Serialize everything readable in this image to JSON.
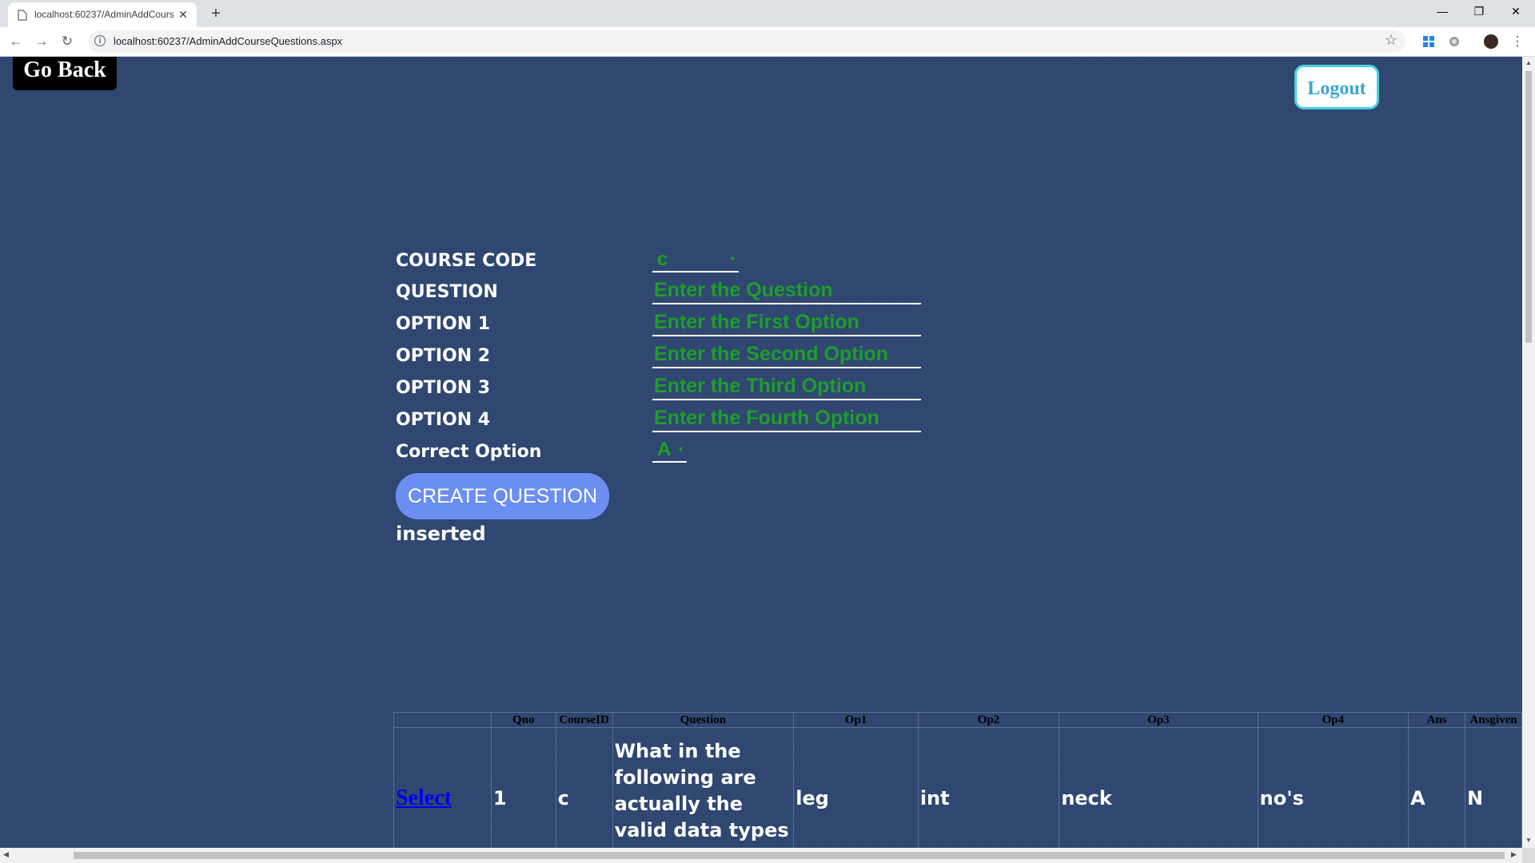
{
  "browser": {
    "tab_title": "localhost:60237/AdminAddCours",
    "url": "localhost:60237/AdminAddCourseQuestions.aspx"
  },
  "nav": {
    "go_back": "Go Back",
    "logout": "Logout"
  },
  "form": {
    "course_code_label": "COURSE CODE",
    "course_code_value": "c",
    "question_label": "QUESTION",
    "question_placeholder": "Enter the Question",
    "option1_label": "OPTION 1",
    "option1_placeholder": "Enter the First Option",
    "option2_label": "OPTION 2",
    "option2_placeholder": "Enter the Second Option",
    "option3_label": "OPTION 3",
    "option3_placeholder": "Enter the Third Option",
    "option4_label": "OPTION 4",
    "option4_placeholder": "Enter the Fourth Option",
    "correct_label": "Correct Option",
    "correct_value": "A",
    "create_button": "CREATE QUESTION",
    "status_message": "inserted"
  },
  "grid": {
    "headers": [
      "",
      "Qno",
      "CourseID",
      "Question",
      "Op1",
      "Op2",
      "Op3",
      "Op4",
      "Ans",
      "Ansgiven"
    ],
    "rows": [
      {
        "select": "Select",
        "qno": "1",
        "course_id": "c",
        "question": "What in the following are actually the valid data types in c?",
        "op1": "leg",
        "op2": "int",
        "op3": "neck",
        "op4": "no's",
        "ans": "A",
        "ansgiven": "N"
      }
    ]
  },
  "colors": {
    "page_background": "#2e4670",
    "input_text": "#1aa51a",
    "button": "#6b8ef2",
    "logout_border": "#48d1e0"
  }
}
